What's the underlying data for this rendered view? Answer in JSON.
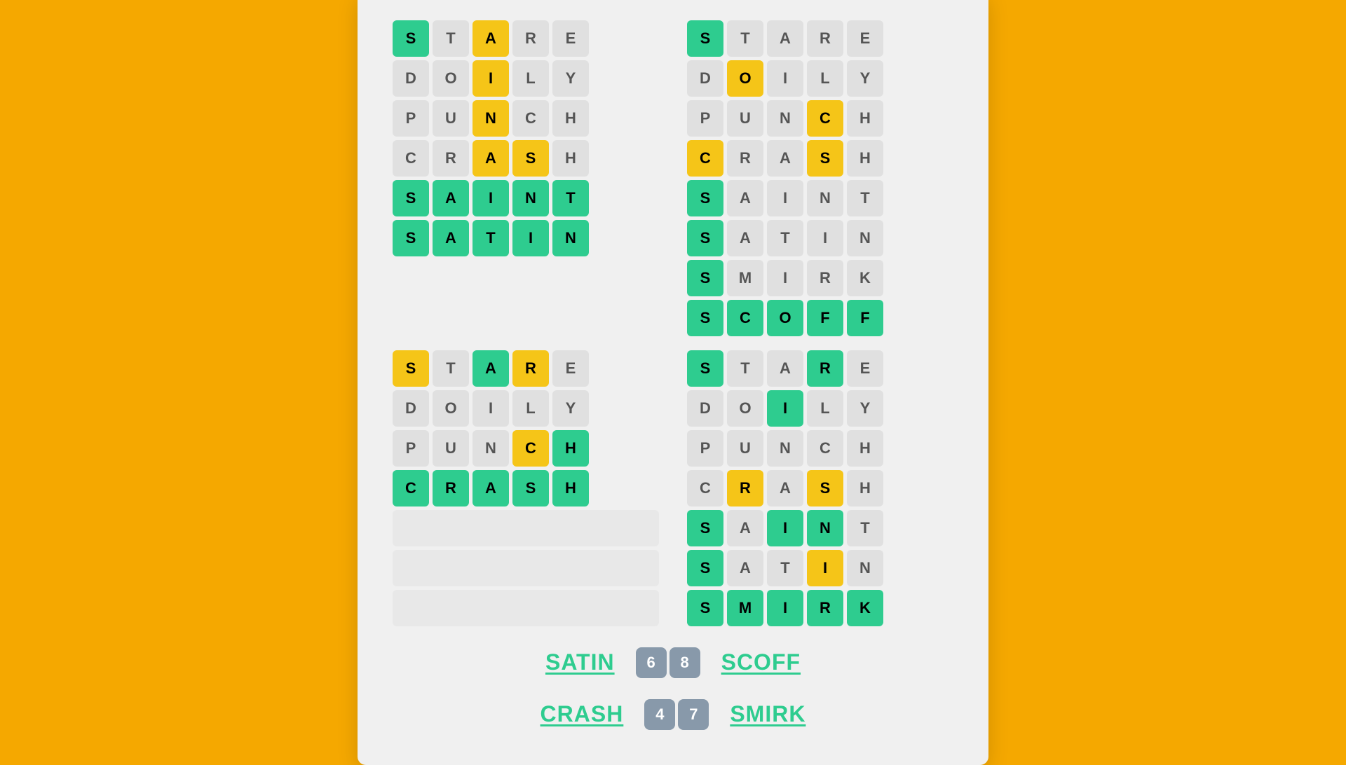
{
  "background_color": "#F5A800",
  "card_bg": "#f0f0f0",
  "grids": [
    {
      "id": "top-left",
      "rows": [
        [
          {
            "letter": "S",
            "state": "green"
          },
          {
            "letter": "T",
            "state": "gray"
          },
          {
            "letter": "A",
            "state": "yellow"
          },
          {
            "letter": "R",
            "state": "gray"
          },
          {
            "letter": "E",
            "state": "gray"
          }
        ],
        [
          {
            "letter": "D",
            "state": "gray"
          },
          {
            "letter": "O",
            "state": "gray"
          },
          {
            "letter": "I",
            "state": "yellow"
          },
          {
            "letter": "L",
            "state": "gray"
          },
          {
            "letter": "Y",
            "state": "gray"
          }
        ],
        [
          {
            "letter": "P",
            "state": "gray"
          },
          {
            "letter": "U",
            "state": "gray"
          },
          {
            "letter": "N",
            "state": "yellow"
          },
          {
            "letter": "C",
            "state": "gray"
          },
          {
            "letter": "H",
            "state": "gray"
          }
        ],
        [
          {
            "letter": "C",
            "state": "gray"
          },
          {
            "letter": "R",
            "state": "gray"
          },
          {
            "letter": "A",
            "state": "yellow"
          },
          {
            "letter": "S",
            "state": "yellow"
          },
          {
            "letter": "H",
            "state": "gray"
          }
        ],
        [
          {
            "letter": "S",
            "state": "green"
          },
          {
            "letter": "A",
            "state": "green"
          },
          {
            "letter": "I",
            "state": "green"
          },
          {
            "letter": "N",
            "state": "green"
          },
          {
            "letter": "T",
            "state": "green"
          }
        ],
        [
          {
            "letter": "S",
            "state": "green"
          },
          {
            "letter": "A",
            "state": "green"
          },
          {
            "letter": "T",
            "state": "green"
          },
          {
            "letter": "I",
            "state": "green"
          },
          {
            "letter": "N",
            "state": "green"
          }
        ]
      ],
      "empty_rows": 0
    },
    {
      "id": "top-right",
      "rows": [
        [
          {
            "letter": "S",
            "state": "green"
          },
          {
            "letter": "T",
            "state": "gray"
          },
          {
            "letter": "A",
            "state": "gray"
          },
          {
            "letter": "R",
            "state": "gray"
          },
          {
            "letter": "E",
            "state": "gray"
          }
        ],
        [
          {
            "letter": "D",
            "state": "gray"
          },
          {
            "letter": "O",
            "state": "yellow"
          },
          {
            "letter": "I",
            "state": "gray"
          },
          {
            "letter": "L",
            "state": "gray"
          },
          {
            "letter": "Y",
            "state": "gray"
          }
        ],
        [
          {
            "letter": "P",
            "state": "gray"
          },
          {
            "letter": "U",
            "state": "gray"
          },
          {
            "letter": "N",
            "state": "gray"
          },
          {
            "letter": "C",
            "state": "yellow"
          },
          {
            "letter": "H",
            "state": "gray"
          }
        ],
        [
          {
            "letter": "C",
            "state": "yellow"
          },
          {
            "letter": "R",
            "state": "gray"
          },
          {
            "letter": "A",
            "state": "gray"
          },
          {
            "letter": "S",
            "state": "yellow"
          },
          {
            "letter": "H",
            "state": "gray"
          }
        ],
        [
          {
            "letter": "S",
            "state": "green"
          },
          {
            "letter": "A",
            "state": "gray"
          },
          {
            "letter": "I",
            "state": "gray"
          },
          {
            "letter": "N",
            "state": "gray"
          },
          {
            "letter": "T",
            "state": "gray"
          }
        ],
        [
          {
            "letter": "S",
            "state": "green"
          },
          {
            "letter": "A",
            "state": "gray"
          },
          {
            "letter": "T",
            "state": "gray"
          },
          {
            "letter": "I",
            "state": "gray"
          },
          {
            "letter": "N",
            "state": "gray"
          }
        ],
        [
          {
            "letter": "S",
            "state": "green"
          },
          {
            "letter": "M",
            "state": "gray"
          },
          {
            "letter": "I",
            "state": "gray"
          },
          {
            "letter": "R",
            "state": "gray"
          },
          {
            "letter": "K",
            "state": "gray"
          }
        ],
        [
          {
            "letter": "S",
            "state": "green"
          },
          {
            "letter": "C",
            "state": "green"
          },
          {
            "letter": "O",
            "state": "green"
          },
          {
            "letter": "F",
            "state": "green"
          },
          {
            "letter": "F",
            "state": "green"
          }
        ]
      ],
      "empty_rows": 0
    },
    {
      "id": "bottom-left",
      "rows": [
        [
          {
            "letter": "S",
            "state": "yellow"
          },
          {
            "letter": "T",
            "state": "gray"
          },
          {
            "letter": "A",
            "state": "green"
          },
          {
            "letter": "R",
            "state": "yellow"
          },
          {
            "letter": "E",
            "state": "gray"
          }
        ],
        [
          {
            "letter": "D",
            "state": "gray"
          },
          {
            "letter": "O",
            "state": "gray"
          },
          {
            "letter": "I",
            "state": "gray"
          },
          {
            "letter": "L",
            "state": "gray"
          },
          {
            "letter": "Y",
            "state": "gray"
          }
        ],
        [
          {
            "letter": "P",
            "state": "gray"
          },
          {
            "letter": "U",
            "state": "gray"
          },
          {
            "letter": "N",
            "state": "gray"
          },
          {
            "letter": "C",
            "state": "yellow"
          },
          {
            "letter": "H",
            "state": "green"
          }
        ],
        [
          {
            "letter": "C",
            "state": "green"
          },
          {
            "letter": "R",
            "state": "green"
          },
          {
            "letter": "A",
            "state": "green"
          },
          {
            "letter": "S",
            "state": "green"
          },
          {
            "letter": "H",
            "state": "green"
          }
        ]
      ],
      "empty_rows": 3
    },
    {
      "id": "bottom-right",
      "rows": [
        [
          {
            "letter": "S",
            "state": "green"
          },
          {
            "letter": "T",
            "state": "gray"
          },
          {
            "letter": "A",
            "state": "gray"
          },
          {
            "letter": "R",
            "state": "green"
          },
          {
            "letter": "E",
            "state": "gray"
          }
        ],
        [
          {
            "letter": "D",
            "state": "gray"
          },
          {
            "letter": "O",
            "state": "gray"
          },
          {
            "letter": "I",
            "state": "green"
          },
          {
            "letter": "L",
            "state": "gray"
          },
          {
            "letter": "Y",
            "state": "gray"
          }
        ],
        [
          {
            "letter": "P",
            "state": "gray"
          },
          {
            "letter": "U",
            "state": "gray"
          },
          {
            "letter": "N",
            "state": "gray"
          },
          {
            "letter": "C",
            "state": "gray"
          },
          {
            "letter": "H",
            "state": "gray"
          }
        ],
        [
          {
            "letter": "C",
            "state": "gray"
          },
          {
            "letter": "R",
            "state": "yellow"
          },
          {
            "letter": "A",
            "state": "gray"
          },
          {
            "letter": "S",
            "state": "yellow"
          },
          {
            "letter": "H",
            "state": "gray"
          }
        ],
        [
          {
            "letter": "S",
            "state": "green"
          },
          {
            "letter": "A",
            "state": "gray"
          },
          {
            "letter": "I",
            "state": "green"
          },
          {
            "letter": "N",
            "state": "green"
          },
          {
            "letter": "T",
            "state": "gray"
          }
        ],
        [
          {
            "letter": "S",
            "state": "green"
          },
          {
            "letter": "A",
            "state": "gray"
          },
          {
            "letter": "T",
            "state": "gray"
          },
          {
            "letter": "I",
            "state": "yellow"
          },
          {
            "letter": "N",
            "state": "gray"
          }
        ],
        [
          {
            "letter": "S",
            "state": "green"
          },
          {
            "letter": "M",
            "state": "green"
          },
          {
            "letter": "I",
            "state": "green"
          },
          {
            "letter": "R",
            "state": "green"
          },
          {
            "letter": "K",
            "state": "green"
          }
        ]
      ],
      "empty_rows": 0
    }
  ],
  "footer": {
    "row1": {
      "left_word": "SATIN",
      "scores": [
        "6",
        "8"
      ],
      "right_word": "SCOFF"
    },
    "row2": {
      "left_word": "CRASH",
      "scores": [
        "4",
        "7"
      ],
      "right_word": "SMIRK"
    }
  }
}
